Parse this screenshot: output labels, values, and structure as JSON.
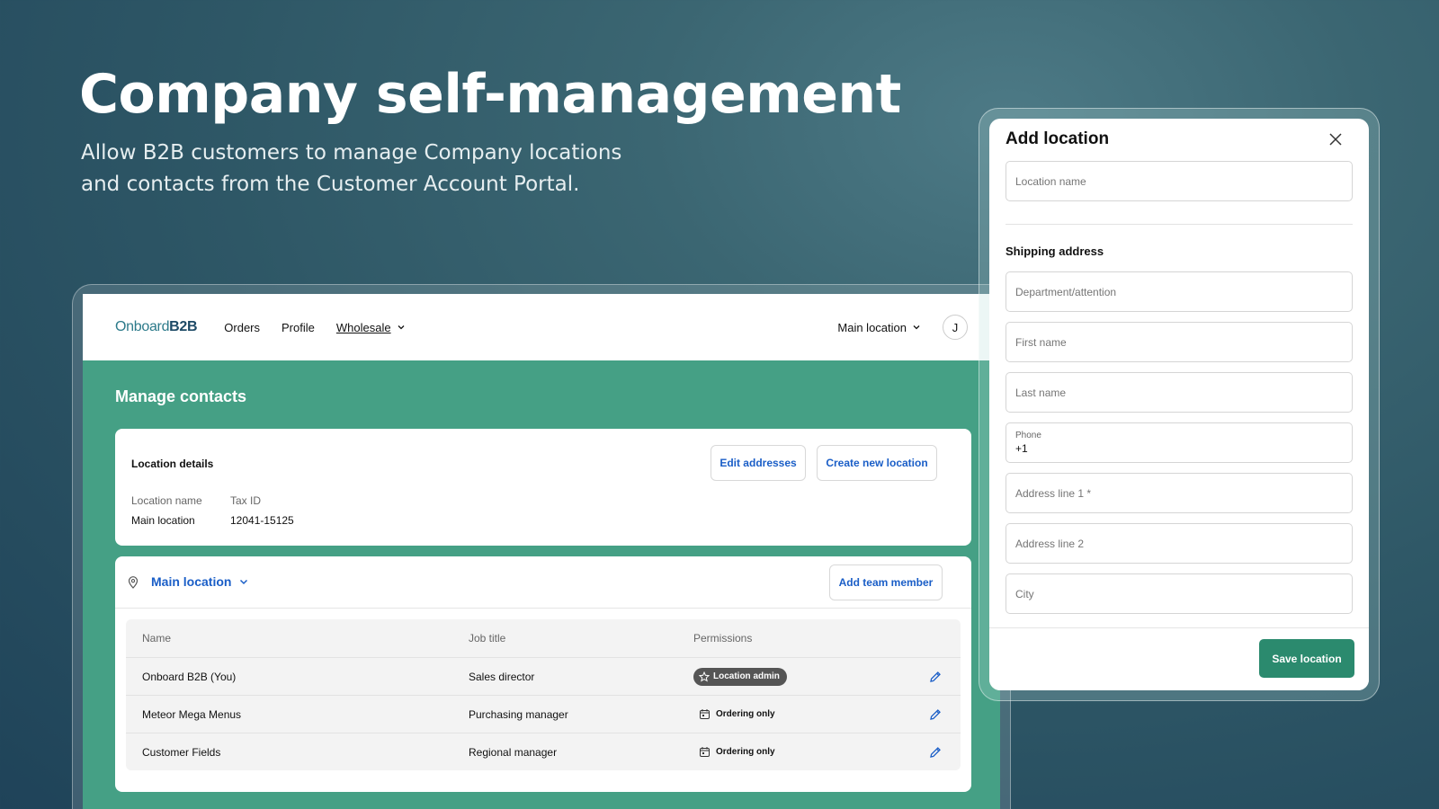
{
  "hero": {
    "title": "Company self-management",
    "subtitle_line1": "Allow B2B customers to manage Company locations",
    "subtitle_line2": "and contacts from the Customer Account Portal."
  },
  "topbar": {
    "logo_prefix": "Onboard",
    "logo_suffix": "B2B",
    "nav": [
      "Orders",
      "Profile",
      "Wholesale"
    ],
    "location_switcher": "Main location",
    "avatar_initial": "J"
  },
  "page": {
    "title": "Manage contacts"
  },
  "location_details": {
    "heading": "Location details",
    "edit_button": "Edit addresses",
    "create_button": "Create new location",
    "location_name_label": "Location name",
    "location_name_value": "Main location",
    "tax_id_label": "Tax ID",
    "tax_id_value": "12041-15125"
  },
  "team": {
    "location": "Main location",
    "add_button": "Add team member",
    "columns": [
      "Name",
      "Job title",
      "Permissions"
    ],
    "rows": [
      {
        "name": "Onboard B2B (You)",
        "job": "Sales director",
        "permission": "Location admin",
        "type": "admin"
      },
      {
        "name": "Meteor Mega Menus",
        "job": "Purchasing manager",
        "permission": "Ordering only",
        "type": "order"
      },
      {
        "name": "Customer Fields",
        "job": "Regional manager",
        "permission": "Ordering only",
        "type": "order"
      }
    ]
  },
  "modal": {
    "title": "Add location",
    "location_name_placeholder": "Location name",
    "shipping_heading": "Shipping address",
    "department_placeholder": "Department/attention",
    "first_name_placeholder": "First name",
    "last_name_placeholder": "Last name",
    "phone_label": "Phone",
    "phone_value": "+1",
    "address1_placeholder": "Address line 1 *",
    "address2_placeholder": "Address line 2",
    "city_placeholder": "City",
    "save_button": "Save location"
  },
  "colors": {
    "portal_green": "#45a085",
    "link_blue": "#1a5ec7",
    "save_green": "#2b8a6e"
  }
}
